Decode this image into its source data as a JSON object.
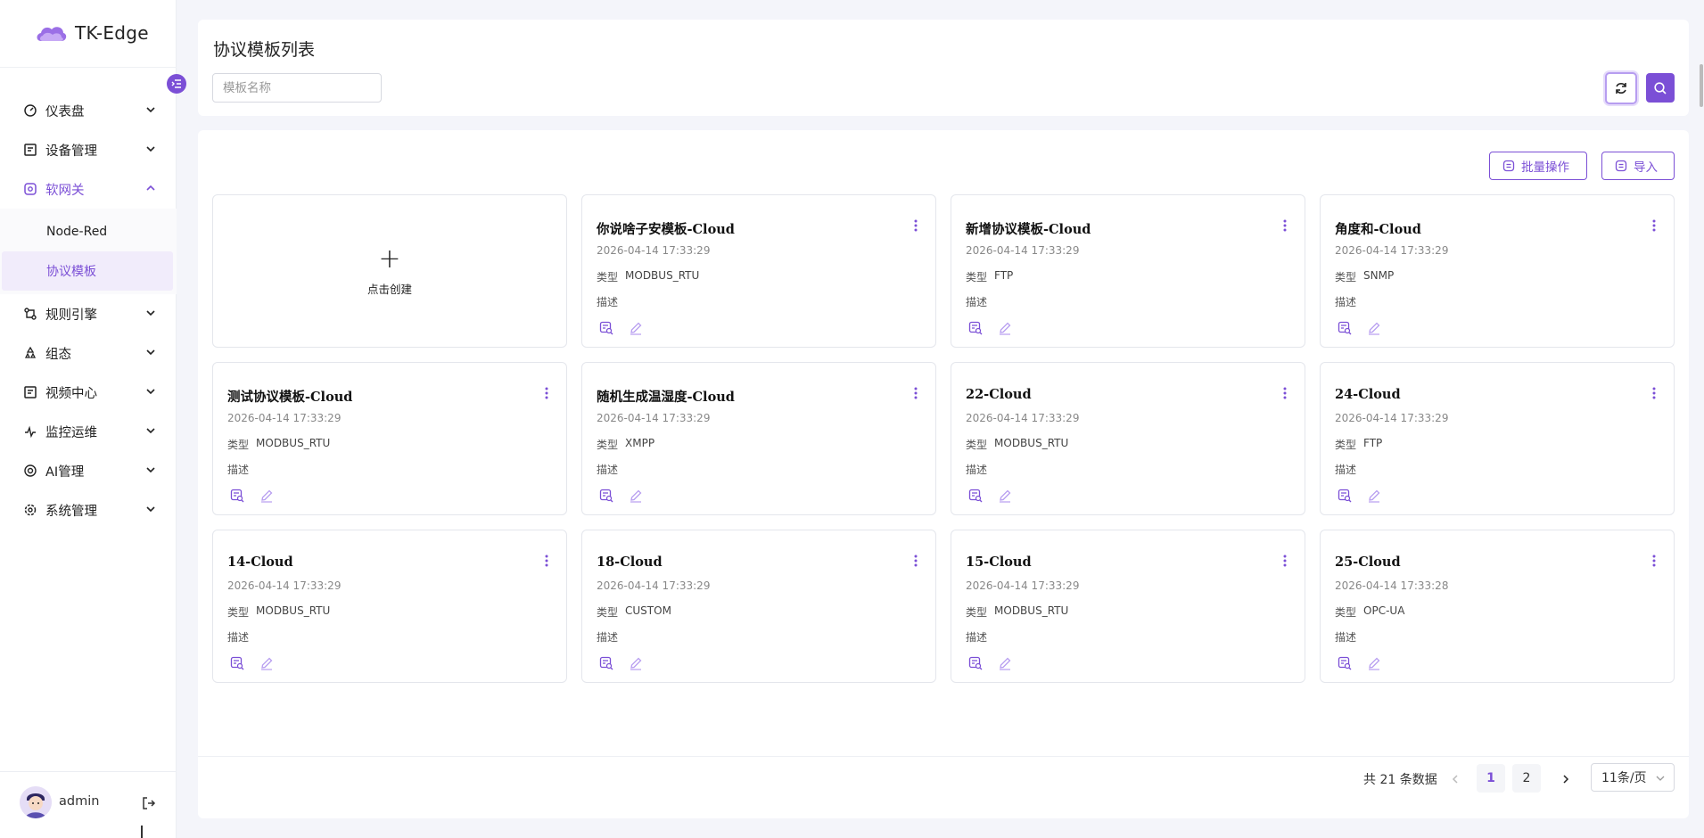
{
  "app": {
    "name": "TK-Edge"
  },
  "sidebar": {
    "items": [
      {
        "label": "仪表盘",
        "icon": "dashboard-icon"
      },
      {
        "label": "设备管理",
        "icon": "device-icon"
      },
      {
        "label": "软网关",
        "icon": "gateway-icon",
        "active": true,
        "children": [
          {
            "label": "Node-Red"
          },
          {
            "label": "协议模板",
            "active": true
          }
        ]
      },
      {
        "label": "规则引擎",
        "icon": "rule-icon"
      },
      {
        "label": "组态",
        "icon": "config-icon"
      },
      {
        "label": "视频中心",
        "icon": "video-icon"
      },
      {
        "label": "监控运维",
        "icon": "monitor-icon"
      },
      {
        "label": "AI管理",
        "icon": "ai-icon"
      },
      {
        "label": "系统管理",
        "icon": "settings-icon"
      }
    ],
    "user": {
      "name": "admin"
    }
  },
  "header": {
    "title": "协议模板列表",
    "search_placeholder": "模板名称"
  },
  "toolbar": {
    "batch_label": "批量操作",
    "import_label": "导入"
  },
  "create_card": {
    "label": "点击创建"
  },
  "cards": [
    {
      "title": "你说啥子安模板-Cloud",
      "time": "2026-04-14 17:33:29",
      "type_key": "类型",
      "type": "MODBUS_RTU",
      "desc": "描述"
    },
    {
      "title": "新增协议模板-Cloud",
      "time": "2026-04-14 17:33:29",
      "type_key": "类型",
      "type": "FTP",
      "desc": "描述"
    },
    {
      "title": "角度和-Cloud",
      "time": "2026-04-14 17:33:29",
      "type_key": "类型",
      "type": "SNMP",
      "desc": "描述"
    },
    {
      "title": "测试协议模板-Cloud",
      "time": "2026-04-14 17:33:29",
      "type_key": "类型",
      "type": "MODBUS_RTU",
      "desc": "描述"
    },
    {
      "title": "随机生成温湿度-Cloud",
      "time": "2026-04-14 17:33:29",
      "type_key": "类型",
      "type": "XMPP",
      "desc": "描述"
    },
    {
      "title": "22-Cloud",
      "time": "2026-04-14 17:33:29",
      "type_key": "类型",
      "type": "MODBUS_RTU",
      "desc": "描述"
    },
    {
      "title": "24-Cloud",
      "time": "2026-04-14 17:33:29",
      "type_key": "类型",
      "type": "FTP",
      "desc": "描述"
    },
    {
      "title": "14-Cloud",
      "time": "2026-04-14 17:33:29",
      "type_key": "类型",
      "type": "MODBUS_RTU",
      "desc": "描述"
    },
    {
      "title": "18-Cloud",
      "time": "2026-04-14 17:33:29",
      "type_key": "类型",
      "type": "CUSTOM",
      "desc": "描述"
    },
    {
      "title": "15-Cloud",
      "time": "2026-04-14 17:33:29",
      "type_key": "类型",
      "type": "MODBUS_RTU",
      "desc": "描述"
    },
    {
      "title": "25-Cloud",
      "time": "2026-04-14 17:33:28",
      "type_key": "类型",
      "type": "OPC-UA",
      "desc": "描述"
    }
  ],
  "pagination": {
    "total_text": "共 21 条数据",
    "pages": [
      "1",
      "2"
    ],
    "current": "1",
    "page_size": "11条/页"
  },
  "colors": {
    "accent": "#7b4fd6",
    "background": "#f4f5fa"
  }
}
